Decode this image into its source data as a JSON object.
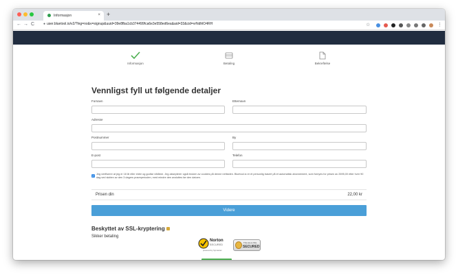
{
  "browser": {
    "tab_title": "Informasjon",
    "tab_close": "×",
    "new_tab": "+",
    "url": "user.bluetool.io/v2/?lng=no&v=signup&uuid=39e8fba1cb374499fca6e3e558ed6ea&aid=33&cid=vrNdhlO4RH",
    "nav_back": "←",
    "nav_forward": "→",
    "nav_reload": "C",
    "lock_icon": "🔒",
    "star_icon": "☆",
    "menu_icon": "⋮"
  },
  "steps": [
    {
      "label": "Informasjon",
      "icon": "check-icon",
      "state": "done"
    },
    {
      "label": "Betaling",
      "icon": "payment-icon",
      "state": "pending"
    },
    {
      "label": "Bekreftelse",
      "icon": "document-icon",
      "state": "pending"
    }
  ],
  "form": {
    "title": "Vennligst fyll ut følgende detaljer",
    "fields": {
      "firstname": {
        "label": "Fornavn",
        "value": ""
      },
      "lastname": {
        "label": "Etternavn",
        "value": ""
      },
      "address": {
        "label": "Adresse",
        "value": ""
      },
      "zip": {
        "label": "Postnummer",
        "value": ""
      },
      "city": {
        "label": "By",
        "value": ""
      },
      "email": {
        "label": "E-post",
        "value": ""
      },
      "phone": {
        "label": "Telefon",
        "value": ""
      }
    },
    "consent_checked": true,
    "consent_text": "Jeg verifiserer at jeg er 18 år eller eldre og godtar vilkårne. Jeg aksepterer også bruken av cookies på denne nettsiden. Bluetool.io er et personlig basert på et automatisk abonnement, som fornyes for prisen av 2695,00 etter hver 90 dag ved slutten av den 3 dagers prøveperioden, med mindre den avsluttes før den datoen.",
    "price_label": "Prisen din",
    "price_value": "22,00 kr",
    "submit_label": "Videre"
  },
  "security": {
    "title": "Beskyttet av SSL-kryptering",
    "subtitle": "Sikker betaling",
    "norton_brand": "Norton",
    "norton_secured": "SECURED",
    "norton_powered": "powered by Symantec",
    "ssl_badge_top": "This site is SSL",
    "ssl_badge_bottom": "SECURED"
  },
  "colors": {
    "header_bg": "#212d40",
    "button_bg": "#4a9fd8",
    "check_green": "#4caf50"
  }
}
